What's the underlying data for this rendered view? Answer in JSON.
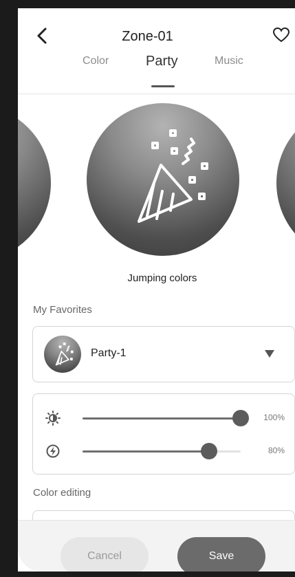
{
  "header": {
    "title": "Zone-01"
  },
  "tabs": [
    {
      "label": "Color",
      "active": false
    },
    {
      "label": "Party",
      "active": true
    },
    {
      "label": "Music",
      "active": false
    }
  ],
  "carousel": {
    "selected_mode": "Jumping colors",
    "icon": "party-popper-icon"
  },
  "favorites": {
    "section_label": "My Favorites",
    "selected": "Party-1"
  },
  "sliders": [
    {
      "name": "brightness",
      "icon": "brightness-icon",
      "value": 1.0,
      "value_label": "100%"
    },
    {
      "name": "speed",
      "icon": "speed-icon",
      "value": 0.8,
      "value_label": "80%"
    }
  ],
  "color_editing": {
    "section_label": "Color editing"
  },
  "footer": {
    "cancel_label": "Cancel",
    "save_label": "Save"
  },
  "colors": {
    "accent": "#6b6b6b",
    "text": "#222222",
    "muted": "#8c8c8c"
  }
}
